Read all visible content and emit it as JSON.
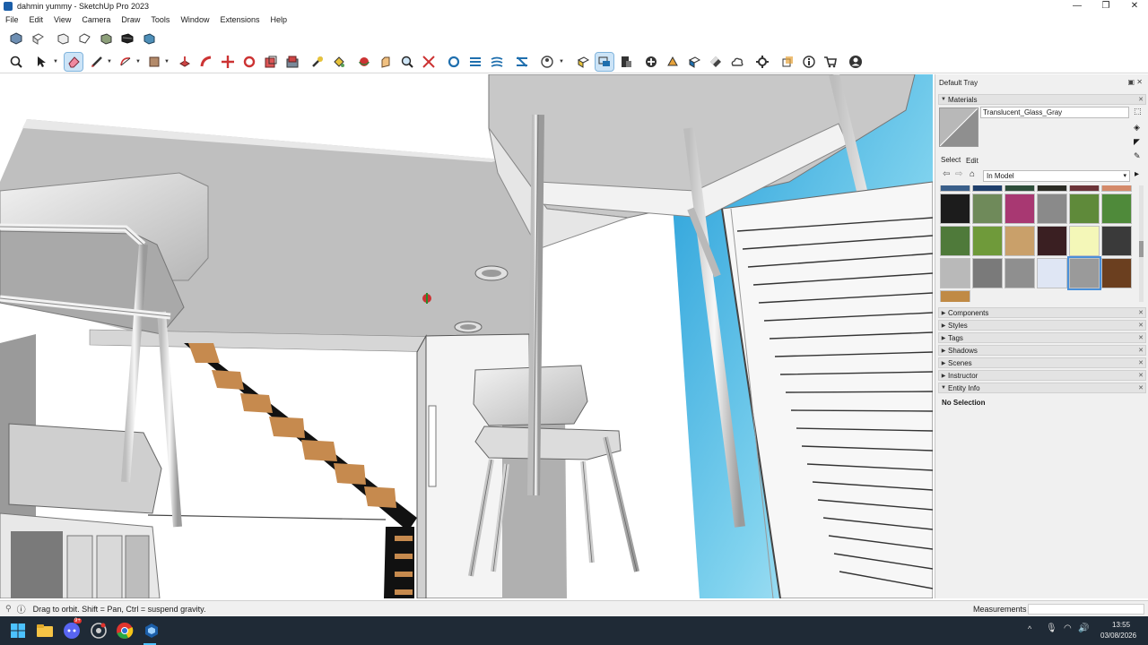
{
  "window": {
    "title": "dahmin yummy - SketchUp Pro 2023",
    "minimize_glyph": "—",
    "maximize_glyph": "❐",
    "close_glyph": "✕"
  },
  "menu": [
    "File",
    "Edit",
    "View",
    "Camera",
    "Draw",
    "Tools",
    "Window",
    "Extensions",
    "Help"
  ],
  "toolbar_icons": {
    "row1": [
      "iso-view-icon",
      "top-view-icon",
      "front-view-icon",
      "right-view-icon",
      "back-view-icon",
      "left-view-icon",
      "bottom-view-icon"
    ],
    "row2": [
      "search-icon",
      "select-icon",
      "eraser-icon",
      "pencil-line-icon",
      "arc-icon",
      "rectangle-icon",
      "push-pull-icon",
      "follow-me-icon",
      "move-icon",
      "rotate-icon",
      "scale-icon",
      "offset-icon",
      "tape-measure-icon",
      "paint-bucket-icon",
      "orbit-icon",
      "pan-icon",
      "zoom-icon",
      "zoom-extents-icon",
      "section-plane-icon",
      "display-section-icon",
      "display-cuts-icon",
      "section-fill-icon",
      "style-icon",
      "warehouse-icon",
      "extension-warehouse-icon",
      "layout-icon",
      "add-location-icon",
      "geo-icon",
      "texture-icon",
      "cloud-icon",
      "extension-manager-icon",
      "component-icon",
      "info-icon",
      "cart-icon",
      "account-icon"
    ]
  },
  "tray": {
    "title": "Default Tray",
    "materials_label": "Materials",
    "material_name": "Translucent_Glass_Gray",
    "tab_select": "Select",
    "tab_edit": "Edit",
    "library": "In Model",
    "panels": [
      "Components",
      "Styles",
      "Tags",
      "Shadows",
      "Scenes",
      "Instructor",
      "Entity Info"
    ],
    "entity_info_value": "No Selection",
    "swatch_colors": [
      "#3a5f8a",
      "#1f3f6b",
      "#2e4e3a",
      "#2b2b24",
      "#6b3338",
      "#d48a6a",
      "#1c1c1c",
      "#6f8a5a",
      "#a83872",
      "#8a8a8a",
      "#5f8a3a",
      "#4f8a3a",
      "#4f7a3a",
      "#6f9a3a",
      "#c9a06a",
      "#3a1f22",
      "#f4f7b8",
      "#3a3a3a",
      "#b9b9b9",
      "#7a7a7a",
      "#8f8f8f",
      "#dfe6f4",
      "#9a9a9a",
      "#6b3f1f",
      "#c08a45"
    ]
  },
  "status": {
    "hint": "Drag to orbit. Shift = Pan, Ctrl = suspend gravity.",
    "measurements_label": "Measurements"
  },
  "taskbar": {
    "discord_badge": "9+",
    "time": "13:55",
    "date": "03/08/2026",
    "tray_caret": "^"
  }
}
